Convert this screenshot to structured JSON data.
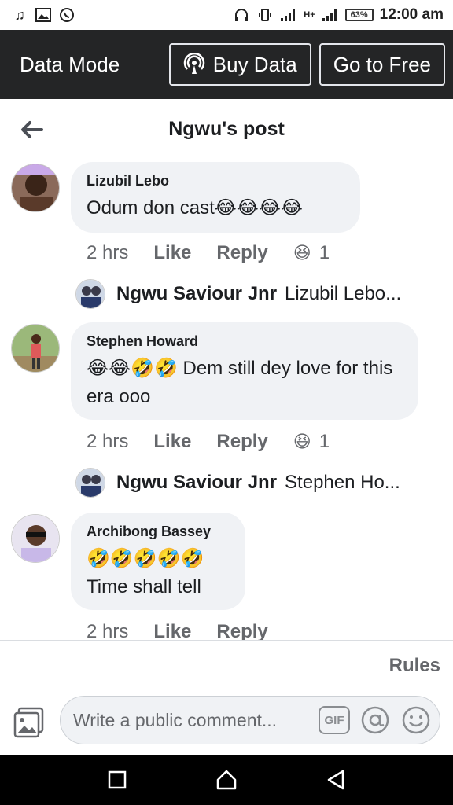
{
  "status_bar": {
    "battery": "63%",
    "time": "12:00 am",
    "network": "H+"
  },
  "data_bar": {
    "title": "Data Mode",
    "buy_label": "Buy Data",
    "free_label": "Go to Free"
  },
  "header": {
    "title": "Ngwu's post"
  },
  "comments": [
    {
      "author": "Lizubil Lebo",
      "text": "Odum don cast😂😂😂😂",
      "time": "2 hrs",
      "like": "Like",
      "reply": "Reply",
      "reaction_icon": "😆",
      "reaction_count": "1",
      "reply_author": "Ngwu Saviour Jnr",
      "reply_preview": "Lizubil Lebo..."
    },
    {
      "author": "Stephen Howard",
      "text": "😂😂🤣🤣 Dem still dey love for this era ooo",
      "time": "2 hrs",
      "like": "Like",
      "reply": "Reply",
      "reaction_icon": "😆",
      "reaction_count": "1",
      "reply_author": "Ngwu Saviour Jnr",
      "reply_preview": "Stephen Ho..."
    },
    {
      "author": "Archibong Bassey",
      "text_line1": "🤣🤣🤣🤣🤣",
      "text_line2": "Time shall tell",
      "time": "2 hrs",
      "like": "Like",
      "reply": "Reply"
    }
  ],
  "composer": {
    "rules": "Rules",
    "placeholder": "Write a public comment...",
    "gif_label": "GIF"
  }
}
